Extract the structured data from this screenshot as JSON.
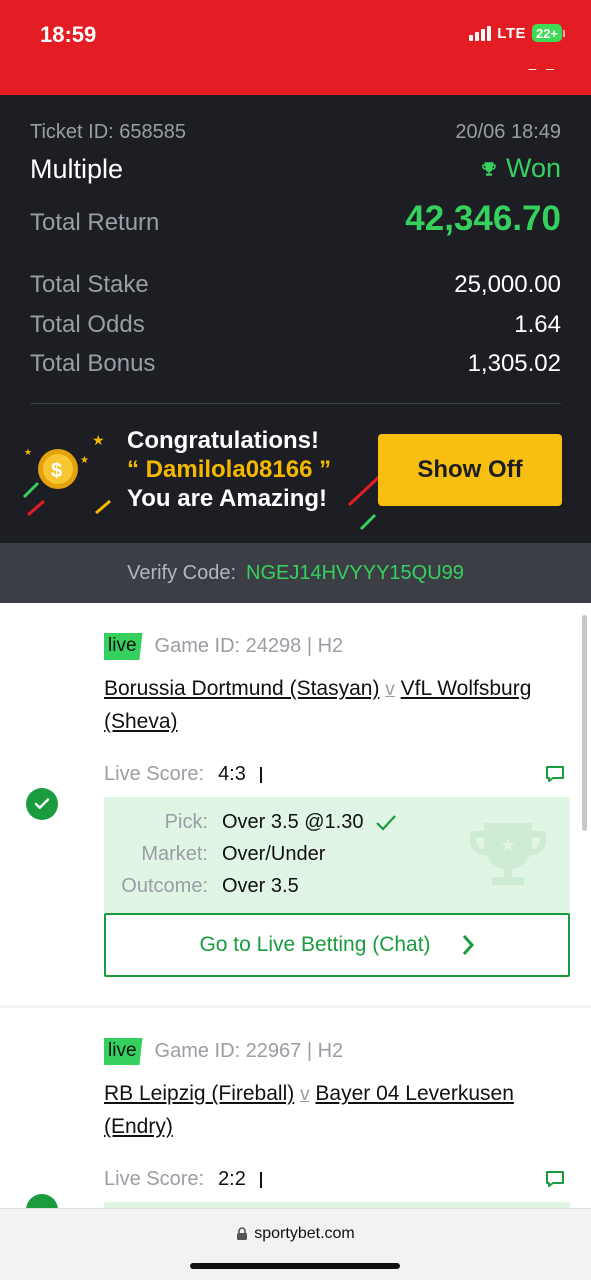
{
  "status_bar": {
    "time": "18:59",
    "network": "LTE",
    "battery": "22+",
    "dashes": "– –"
  },
  "ticket": {
    "ticket_id": "Ticket ID: 658585",
    "datetime": "20/06 18:49",
    "bet_type": "Multiple",
    "status": "Won",
    "total_return_label": "Total Return",
    "total_return": "42,346.70",
    "total_stake_label": "Total Stake",
    "total_stake": "25,000.00",
    "total_odds_label": "Total Odds",
    "total_odds": "1.64",
    "total_bonus_label": "Total Bonus",
    "total_bonus": "1,305.02"
  },
  "congrats": {
    "line1": "Congratulations!",
    "line2": "“ Damilola08166 ”",
    "line3": "You are Amazing!",
    "button": "Show Off"
  },
  "verify": {
    "label": "Verify Code:",
    "code": "NGEJ14HVYYY15QU99"
  },
  "selections": [
    {
      "badge": "live",
      "game_id": "Game ID: 24298 | H2",
      "home": "Borussia Dortmund (Stasyan)",
      "vs": "v",
      "away_first": "VfL Wolfsburg",
      "away_second": "(Sheva)",
      "score_label": "Live Score:",
      "score": "4:3",
      "pick_label": "Pick:",
      "pick": "Over 3.5 @1.30",
      "market_label": "Market:",
      "market": "Over/Under",
      "outcome_label": "Outcome:",
      "outcome": "Over 3.5",
      "live_betting": "Go to Live Betting (Chat)"
    },
    {
      "badge": "live",
      "game_id": "Game ID: 22967 | H2",
      "home": "RB Leipzig (Fireball)",
      "vs": "v",
      "away_first": "Bayer 04 Leverkusen",
      "away_second": "(Endry)",
      "score_label": "Live Score:",
      "score": "2:2"
    }
  ],
  "browser": {
    "url": "sportybet.com"
  },
  "colors": {
    "brand_red": "#e41c23",
    "win_green": "#35d05e",
    "accent_yellow": "#f8bf10",
    "dark_bg": "#1c1e23"
  }
}
